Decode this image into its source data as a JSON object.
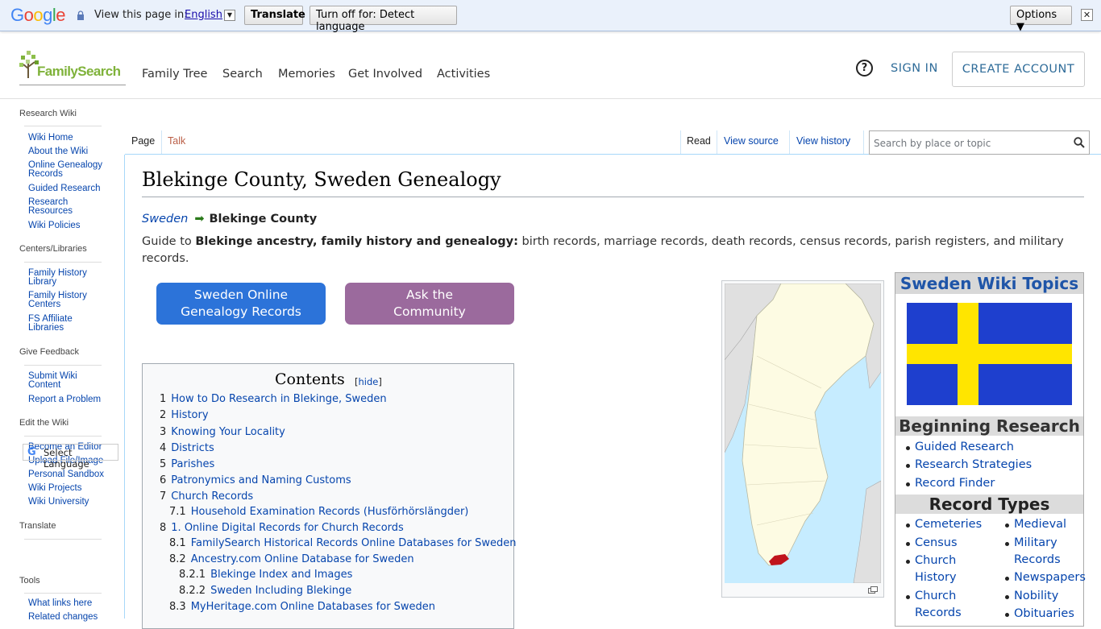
{
  "translate_bar": {
    "view_in": "View this page in:",
    "language": "English",
    "translate_btn": "Translate",
    "turn_off_btn": "Turn off for: Detect language",
    "options_btn": "Options ▼",
    "close": "✕"
  },
  "header": {
    "logo_text": "FamilySearch",
    "nav": [
      "Family Tree",
      "Search",
      "Memories",
      "Get Involved",
      "Activities"
    ],
    "help": "?",
    "sign_in": "SIGN IN",
    "create_account": "CREATE ACCOUNT"
  },
  "sidebar": {
    "research_wiki": "Research Wiki",
    "wiki_links": [
      "Wiki Home",
      "About the Wiki",
      "Online Genealogy Records",
      "Guided Research",
      "Research Resources",
      "Wiki Policies"
    ],
    "centers_title": "Centers/Libraries",
    "centers_links": [
      "Family History Library",
      "Family History Centers",
      "FS Affiliate Libraries"
    ],
    "feedback_title": "Give Feedback",
    "feedback_links": [
      "Submit Wiki Content",
      "Report a Problem"
    ],
    "edit_title": "Edit the Wiki",
    "edit_links": [
      "Become an Editor",
      "Upload File/Image",
      "Personal Sandbox",
      "Wiki Projects",
      "Wiki University"
    ],
    "translate_title": "Translate",
    "select_language": "Select Language",
    "tools_title": "Tools",
    "tools_links": [
      "What links here",
      "Related changes"
    ]
  },
  "tabs": {
    "page": "Page",
    "talk": "Talk",
    "read": "Read",
    "view_source": "View source",
    "view_history": "View history",
    "search_placeholder": "Search by place or topic"
  },
  "content": {
    "title": "Blekinge County, Sweden Genealogy",
    "breadcrumb_parent": "Sweden",
    "breadcrumb_arrow": "➡",
    "breadcrumb_current": "Blekinge County",
    "intro_lead": "Guide to ",
    "intro_bold": "Blekinge ancestry, family history and genealogy:",
    "intro_rest": " birth records, marriage records, death records, census records, parish registers, and military records.",
    "btn_records_line1": "Sweden Online",
    "btn_records_line2": "Genealogy Records",
    "btn_community_line1": "Ask the",
    "btn_community_line2": "Community"
  },
  "toc": {
    "title": "Contents",
    "hide": "hide",
    "items": [
      {
        "num": "1",
        "text": "How to Do Research in Blekinge, Sweden"
      },
      {
        "num": "2",
        "text": "History"
      },
      {
        "num": "3",
        "text": "Knowing Your Locality"
      },
      {
        "num": "4",
        "text": "Districts"
      },
      {
        "num": "5",
        "text": "Parishes"
      },
      {
        "num": "6",
        "text": "Patronymics and Naming Customs"
      },
      {
        "num": "7",
        "text": "Church Records"
      },
      {
        "num": "7.1",
        "text": "Household Examination Records (Husförhörslängder)"
      },
      {
        "num": "8",
        "text": "1. Online Digital Records for Church Records"
      },
      {
        "num": "8.1",
        "text": "FamilySearch Historical Records Online Databases for Sweden"
      },
      {
        "num": "8.2",
        "text": "Ancestry.com Online Database for Sweden"
      },
      {
        "num": "8.2.1",
        "text": "Blekinge Index and Images"
      },
      {
        "num": "8.2.2",
        "text": "Sweden Including Blekinge"
      },
      {
        "num": "8.3",
        "text": "MyHeritage.com Online Databases for Sweden"
      }
    ]
  },
  "topics": {
    "title": "Sweden Wiki Topics",
    "beginning_title": "Beginning Research",
    "beginning_links": [
      "Guided Research",
      "Research Strategies",
      "Record Finder"
    ],
    "record_types_title": "Record Types",
    "left_col": [
      "Cemeteries",
      "Census",
      "Church History",
      "Church Records"
    ],
    "right_col": [
      "Medieval",
      "Military Records",
      "Newspapers",
      "Nobility",
      "Obituaries"
    ]
  },
  "colors": {
    "link": "#0645ad",
    "records_button": "#2c73d9",
    "community_button": "#9b6a9d",
    "flag_blue": "#1e3fce",
    "flag_yellow": "#ffe500",
    "map_highlight": "#c0141c"
  }
}
